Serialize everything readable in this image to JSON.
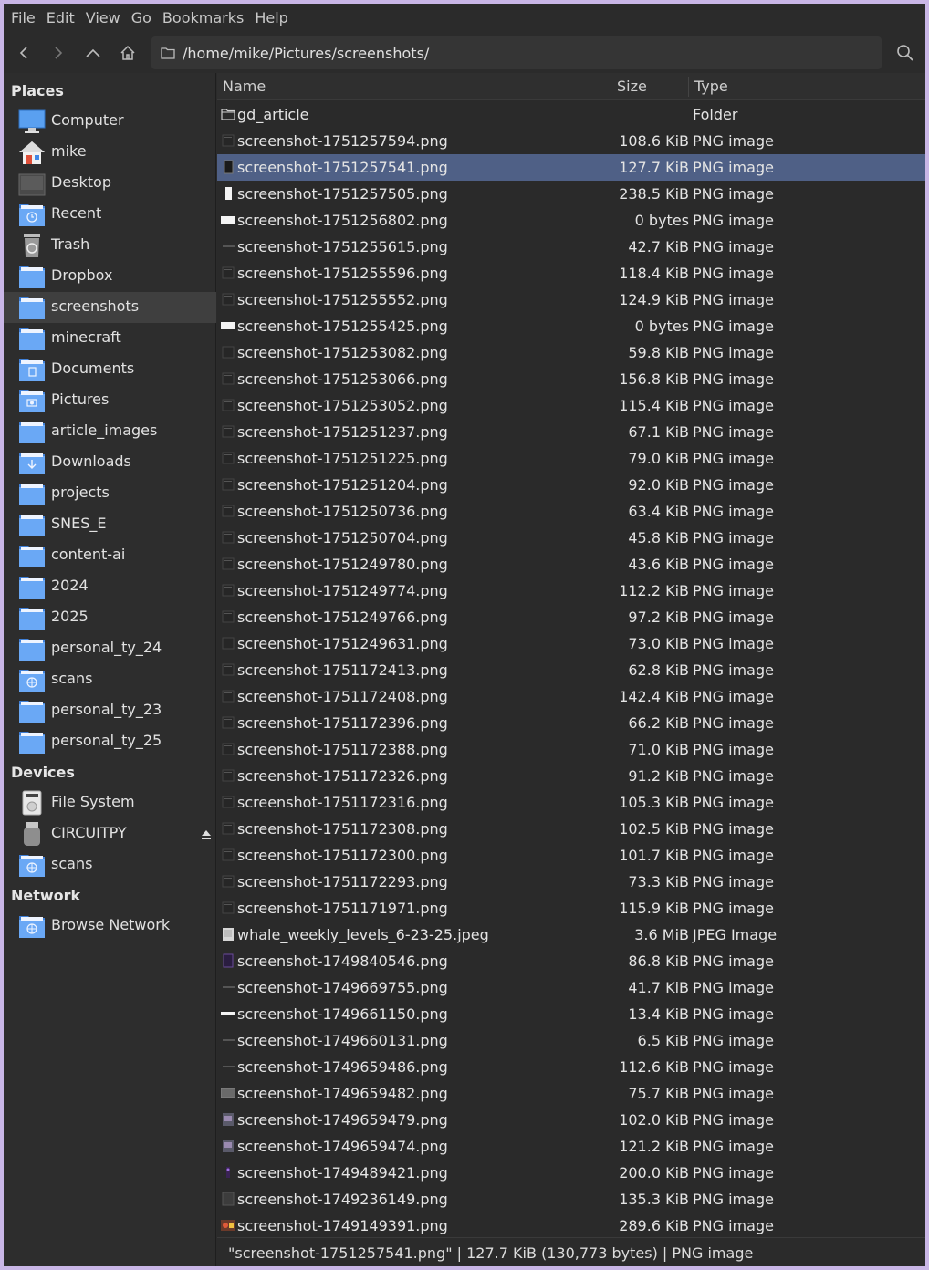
{
  "menu": [
    "File",
    "Edit",
    "View",
    "Go",
    "Bookmarks",
    "Help"
  ],
  "toolbar": {
    "path": "/home/mike/Pictures/screenshots/",
    "icons": [
      "back-icon",
      "forward-icon",
      "up-icon",
      "home-icon",
      "folder-icon",
      "search-icon"
    ]
  },
  "sidebar": {
    "places_header": "Places",
    "devices_header": "Devices",
    "network_header": "Network",
    "places": [
      {
        "label": "Computer",
        "icon": "computer-icon"
      },
      {
        "label": "mike",
        "icon": "home-icon"
      },
      {
        "label": "Desktop",
        "icon": "desktop-icon"
      },
      {
        "label": "Recent",
        "icon": "recent-icon"
      },
      {
        "label": "Trash",
        "icon": "trash-icon"
      },
      {
        "label": "Dropbox",
        "icon": "folder-icon"
      },
      {
        "label": "screenshots",
        "icon": "folder-icon",
        "selected": true
      },
      {
        "label": "minecraft",
        "icon": "folder-icon"
      },
      {
        "label": "Documents",
        "icon": "documents-folder-icon"
      },
      {
        "label": "Pictures",
        "icon": "pictures-folder-icon"
      },
      {
        "label": "article_images",
        "icon": "folder-icon"
      },
      {
        "label": "Downloads",
        "icon": "downloads-folder-icon"
      },
      {
        "label": "projects",
        "icon": "folder-icon"
      },
      {
        "label": "SNES_E",
        "icon": "folder-icon"
      },
      {
        "label": "content-ai",
        "icon": "folder-icon"
      },
      {
        "label": "2024",
        "icon": "folder-icon"
      },
      {
        "label": "2025",
        "icon": "folder-icon"
      },
      {
        "label": "personal_ty_24",
        "icon": "folder-icon"
      },
      {
        "label": "scans",
        "icon": "network-folder-icon"
      },
      {
        "label": "personal_ty_23",
        "icon": "folder-icon"
      },
      {
        "label": "personal_ty_25",
        "icon": "folder-icon"
      }
    ],
    "devices": [
      {
        "label": "File System",
        "icon": "drive-icon"
      },
      {
        "label": "CIRCUITPY",
        "icon": "usb-drive-icon",
        "eject": true
      },
      {
        "label": "scans",
        "icon": "network-folder-icon"
      }
    ],
    "network": [
      {
        "label": "Browse Network",
        "icon": "network-folder-icon"
      }
    ]
  },
  "columns": {
    "name": "Name",
    "size": "Size",
    "type": "Type"
  },
  "files": [
    {
      "name": "gd_article",
      "size": "",
      "type": "Folder",
      "kind": "folder"
    },
    {
      "name": "screenshot-1751257594.png",
      "size": "108.6 KiB",
      "type": "PNG image",
      "kind": "dark"
    },
    {
      "name": "screenshot-1751257541.png",
      "size": "127.7 KiB",
      "type": "PNG image",
      "kind": "tall",
      "selected": true
    },
    {
      "name": "screenshot-1751257505.png",
      "size": "238.5 KiB",
      "type": "PNG image",
      "kind": "white-tall"
    },
    {
      "name": "screenshot-1751256802.png",
      "size": "0 bytes",
      "type": "PNG image",
      "kind": "white"
    },
    {
      "name": "screenshot-1751255615.png",
      "size": "42.7 KiB",
      "type": "PNG image",
      "kind": "line"
    },
    {
      "name": "screenshot-1751255596.png",
      "size": "118.4 KiB",
      "type": "PNG image",
      "kind": "dark"
    },
    {
      "name": "screenshot-1751255552.png",
      "size": "124.9 KiB",
      "type": "PNG image",
      "kind": "dark"
    },
    {
      "name": "screenshot-1751255425.png",
      "size": "0 bytes",
      "type": "PNG image",
      "kind": "white"
    },
    {
      "name": "screenshot-1751253082.png",
      "size": "59.8 KiB",
      "type": "PNG image",
      "kind": "dark"
    },
    {
      "name": "screenshot-1751253066.png",
      "size": "156.8 KiB",
      "type": "PNG image",
      "kind": "dark"
    },
    {
      "name": "screenshot-1751253052.png",
      "size": "115.4 KiB",
      "type": "PNG image",
      "kind": "dark"
    },
    {
      "name": "screenshot-1751251237.png",
      "size": "67.1 KiB",
      "type": "PNG image",
      "kind": "dark"
    },
    {
      "name": "screenshot-1751251225.png",
      "size": "79.0 KiB",
      "type": "PNG image",
      "kind": "dark"
    },
    {
      "name": "screenshot-1751251204.png",
      "size": "92.0 KiB",
      "type": "PNG image",
      "kind": "dark"
    },
    {
      "name": "screenshot-1751250736.png",
      "size": "63.4 KiB",
      "type": "PNG image",
      "kind": "dark"
    },
    {
      "name": "screenshot-1751250704.png",
      "size": "45.8 KiB",
      "type": "PNG image",
      "kind": "dark"
    },
    {
      "name": "screenshot-1751249780.png",
      "size": "43.6 KiB",
      "type": "PNG image",
      "kind": "dark"
    },
    {
      "name": "screenshot-1751249774.png",
      "size": "112.2 KiB",
      "type": "PNG image",
      "kind": "dark"
    },
    {
      "name": "screenshot-1751249766.png",
      "size": "97.2 KiB",
      "type": "PNG image",
      "kind": "dark"
    },
    {
      "name": "screenshot-1751249631.png",
      "size": "73.0 KiB",
      "type": "PNG image",
      "kind": "dark"
    },
    {
      "name": "screenshot-1751172413.png",
      "size": "62.8 KiB",
      "type": "PNG image",
      "kind": "dark"
    },
    {
      "name": "screenshot-1751172408.png",
      "size": "142.4 KiB",
      "type": "PNG image",
      "kind": "dark"
    },
    {
      "name": "screenshot-1751172396.png",
      "size": "66.2 KiB",
      "type": "PNG image",
      "kind": "dark"
    },
    {
      "name": "screenshot-1751172388.png",
      "size": "71.0 KiB",
      "type": "PNG image",
      "kind": "dark"
    },
    {
      "name": "screenshot-1751172326.png",
      "size": "91.2 KiB",
      "type": "PNG image",
      "kind": "dark"
    },
    {
      "name": "screenshot-1751172316.png",
      "size": "105.3 KiB",
      "type": "PNG image",
      "kind": "dark"
    },
    {
      "name": "screenshot-1751172308.png",
      "size": "102.5 KiB",
      "type": "PNG image",
      "kind": "dark"
    },
    {
      "name": "screenshot-1751172300.png",
      "size": "101.7 KiB",
      "type": "PNG image",
      "kind": "dark"
    },
    {
      "name": "screenshot-1751172293.png",
      "size": "73.3 KiB",
      "type": "PNG image",
      "kind": "dark"
    },
    {
      "name": "screenshot-1751171971.png",
      "size": "115.9 KiB",
      "type": "PNG image",
      "kind": "dark"
    },
    {
      "name": "whale_weekly_levels_6-23-25.jpeg",
      "size": "3.6 MiB",
      "type": "JPEG Image",
      "kind": "light"
    },
    {
      "name": "screenshot-1749840546.png",
      "size": "86.8 KiB",
      "type": "PNG image",
      "kind": "purple"
    },
    {
      "name": "screenshot-1749669755.png",
      "size": "41.7 KiB",
      "type": "PNG image",
      "kind": "line"
    },
    {
      "name": "screenshot-1749661150.png",
      "size": "13.4 KiB",
      "type": "PNG image",
      "kind": "white-line"
    },
    {
      "name": "screenshot-1749660131.png",
      "size": "6.5 KiB",
      "type": "PNG image",
      "kind": "line"
    },
    {
      "name": "screenshot-1749659486.png",
      "size": "112.6 KiB",
      "type": "PNG image",
      "kind": "line"
    },
    {
      "name": "screenshot-1749659482.png",
      "size": "75.7 KiB",
      "type": "PNG image",
      "kind": "gray"
    },
    {
      "name": "screenshot-1749659479.png",
      "size": "102.0 KiB",
      "type": "PNG image",
      "kind": "mixed"
    },
    {
      "name": "screenshot-1749659474.png",
      "size": "121.2 KiB",
      "type": "PNG image",
      "kind": "mixed"
    },
    {
      "name": "screenshot-1749489421.png",
      "size": "200.0 KiB",
      "type": "PNG image",
      "kind": "purple-small"
    },
    {
      "name": "screenshot-1749236149.png",
      "size": "135.3 KiB",
      "type": "PNG image",
      "kind": "gray-dark"
    },
    {
      "name": "screenshot-1749149391.png",
      "size": "289.6 KiB",
      "type": "PNG image",
      "kind": "colorful"
    }
  ],
  "status": "\"screenshot-1751257541.png\"  |  127.7 KiB (130,773 bytes)  |  PNG image",
  "colors": {
    "selection": "#4f6086",
    "folder": "#5e9df0",
    "window_border": "#c9b6e6"
  }
}
